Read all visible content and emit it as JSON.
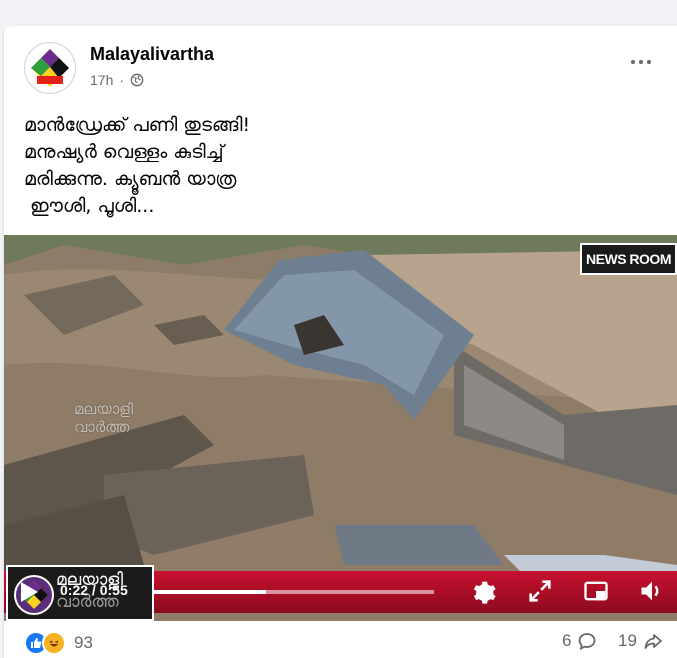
{
  "post": {
    "page_name": "Malayalivartha",
    "time": "17h",
    "visibility_icon": "globe-icon",
    "text_lines": [
      "മാൻഡ്രേക്ക് പണി തുടങ്ങി!",
      "മനുഷ്യർ വെള്ളം കുടിച്ച്",
      "മരിക്കുന്നു. ക്യൂബൻ യാത്ര",
      " ഈശി, പൂശി..."
    ]
  },
  "video": {
    "badge": "NEWS ROOM",
    "watermark_lines": [
      "മലയാളി",
      "വാർത്ത"
    ],
    "channel_lines": [
      "മലയാളി",
      "വാർത്ത"
    ],
    "current_time": "0:22",
    "duration": "0:55",
    "time_separator": " / ",
    "progress": 0.4,
    "colors": {
      "band": "#c8102e",
      "water": "#8a7a66"
    }
  },
  "footer": {
    "reaction_count": "93",
    "comment_count": "6",
    "share_count": "19",
    "reaction_icons": [
      "like-icon",
      "haha-icon"
    ]
  }
}
